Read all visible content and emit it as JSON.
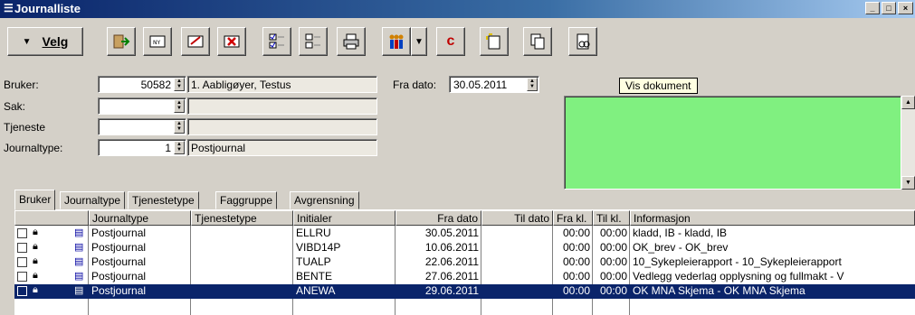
{
  "window": {
    "title": "Journalliste",
    "title_icon": "list-icon",
    "controls": [
      "minimize",
      "maximize",
      "close"
    ]
  },
  "toolbar": {
    "velg_label": "Velg",
    "buttons": [
      "exit-icon",
      "new-document-icon",
      "edit-icon",
      "delete-icon",
      "check-all-icon",
      "uncheck-all-icon",
      "print-icon",
      "people-icon",
      "dropdown-icon",
      "copyright-c-icon",
      "new-note-icon",
      "copy-icon",
      "view-document-icon"
    ]
  },
  "form": {
    "bruker_label": "Bruker:",
    "bruker_value": "50582",
    "bruker_name": "1. Aabligøyer, Testus",
    "sak_label": "Sak:",
    "sak_value": "",
    "sak_name": "",
    "tjeneste_label": "Tjeneste",
    "tjeneste_value": "",
    "tjeneste_name": "",
    "journaltype_label": "Journaltype:",
    "journaltype_value": "1",
    "journaltype_name": "Postjournal",
    "fra_dato_label": "Fra dato:",
    "fra_dato_value": "30.05.2011"
  },
  "tooltip": "Vis dokument",
  "preview_color": "#80f080",
  "tabs": [
    "Bruker",
    "Journaltype",
    "Tjenestetype",
    "Faggruppe",
    "Avgrensning"
  ],
  "grid": {
    "columns": [
      "",
      "Journaltype",
      "Tjenestetype",
      "Initialer",
      "Fra dato",
      "Til dato",
      "Fra kl.",
      "Til kl.",
      "Informasjon"
    ],
    "rows": [
      {
        "journaltype": "Postjournal",
        "tjenestetype": "",
        "initialer": "ELLRU",
        "fra_dato": "30.05.2011",
        "til_dato": "",
        "fra_kl": "00:00",
        "til_kl": "00:00",
        "informasjon": "kladd, IB - kladd, IB"
      },
      {
        "journaltype": "Postjournal",
        "tjenestetype": "",
        "initialer": "VIBD14P",
        "fra_dato": "10.06.2011",
        "til_dato": "",
        "fra_kl": "00:00",
        "til_kl": "00:00",
        "informasjon": "OK_brev - OK_brev"
      },
      {
        "journaltype": "Postjournal",
        "tjenestetype": "",
        "initialer": "TUALP",
        "fra_dato": "22.06.2011",
        "til_dato": "",
        "fra_kl": "00:00",
        "til_kl": "00:00",
        "informasjon": "10_Sykepleierapport - 10_Sykepleierapport"
      },
      {
        "journaltype": "Postjournal",
        "tjenestetype": "",
        "initialer": "BENTE",
        "fra_dato": "27.06.2011",
        "til_dato": "",
        "fra_kl": "00:00",
        "til_kl": "00:00",
        "informasjon": "Vedlegg vederlag opplysning og fullmakt - V"
      },
      {
        "journaltype": "Postjournal",
        "tjenestetype": "",
        "initialer": "ANEWA",
        "fra_dato": "29.06.2011",
        "til_dato": "",
        "fra_kl": "00:00",
        "til_kl": "00:00",
        "informasjon": "OK MNA Skjema - OK MNA Skjema"
      }
    ],
    "selected_row": 4
  }
}
